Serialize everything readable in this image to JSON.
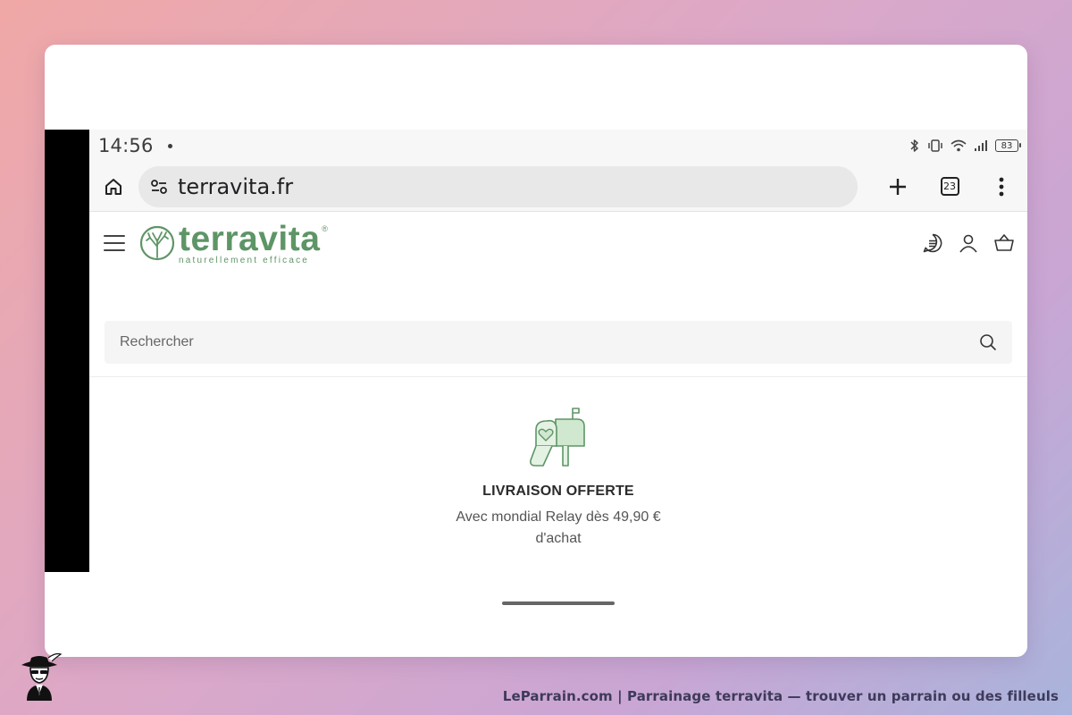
{
  "status_bar": {
    "time": "14:56",
    "battery": "83",
    "icons": [
      "bluetooth-icon",
      "vibrate-icon",
      "wifi-icon",
      "signal-icon",
      "battery-icon"
    ]
  },
  "browser": {
    "url": "terravita.fr",
    "tab_count": "23",
    "icons": [
      "home-icon",
      "site-settings-icon",
      "new-tab-icon",
      "tabs-icon",
      "more-vert-icon"
    ]
  },
  "site": {
    "logo_name": "terravita",
    "logo_tagline": "naturellement efficace",
    "brand_color": "#5e9566",
    "header_icons": [
      "menu-icon",
      "chat-icon",
      "account-icon",
      "basket-icon"
    ],
    "search_placeholder": "Rechercher"
  },
  "promo": {
    "icon": "mailbox-heart-icon",
    "title": "LIVRAISON OFFERTE",
    "subtitle": "Avec mondial Relay dès 49,90 € d'achat"
  },
  "footer": {
    "caption": "LeParrain.com | Parrainage terravita — trouver un parrain ou des filleuls"
  }
}
